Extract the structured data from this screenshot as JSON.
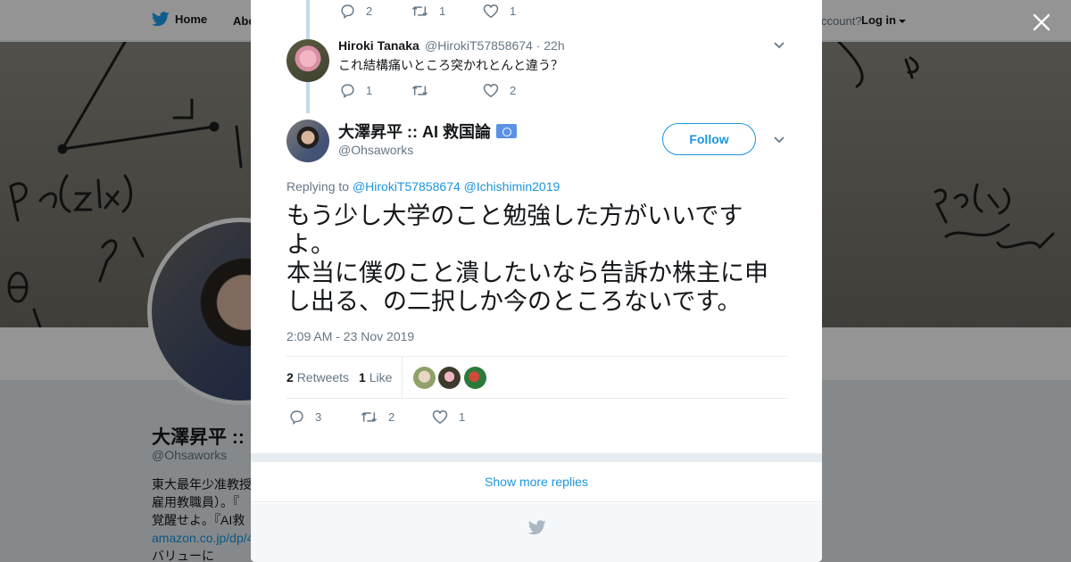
{
  "topbar": {
    "home_label": "Home",
    "about_label": "Abo",
    "account_text": "ccount?",
    "login_label": "Log in"
  },
  "profile": {
    "name": "大澤昇平 ::",
    "handle": "@Ohsaworks",
    "bio_lines": [
      "東大最年少准教授",
      "雇用教職員）。『",
      "覚醒せよ。『AI救",
      "amazon.co.jp/dp/4",
      "バリューに"
    ]
  },
  "thread": {
    "prev_actions": {
      "replies": "2",
      "retweets": "1",
      "likes": "1"
    },
    "reply": {
      "name": "Hiroki Tanaka",
      "handle_time": "@HirokiT57858674 · 22h",
      "text": "これ結構痛いところ突かれとんと違う？",
      "actions": {
        "replies": "1",
        "retweets": "",
        "likes": "2"
      }
    }
  },
  "main_tweet": {
    "name": "大澤昇平 :: AI 救国論",
    "handle": "@Ohsaworks",
    "follow_label": "Follow",
    "replying_label": "Replying to",
    "mention_1": "@HirokiT57858674",
    "mention_2": "@Ichishimin2019",
    "text_lines": [
      "もう少し大学のこと勉強した方がいいです",
      "よ。",
      "本当に僕のこと潰したいなら告訴か株主に申",
      "し出る、の二択しか今のところないです。"
    ],
    "timestamp": "2:09 AM - 23 Nov 2019",
    "stats": {
      "retweets_count": "2",
      "retweets_label": "Retweets",
      "likes_count": "1",
      "likes_label": "Like"
    },
    "actions": {
      "replies": "3",
      "retweets": "2",
      "likes": "1"
    }
  },
  "show_more_label": "Show more replies",
  "colors": {
    "accent": "#1b95e0",
    "thread_line": "#c4d9ec",
    "muted": "#657786"
  }
}
